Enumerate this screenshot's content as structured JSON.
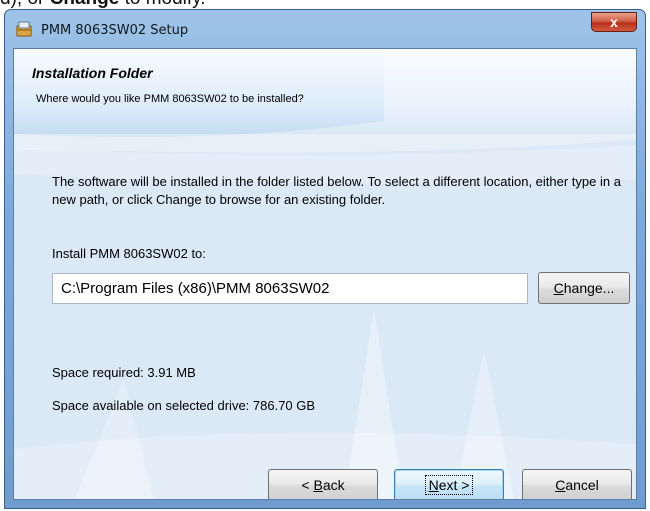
{
  "doc": {
    "prefix": "d), or ",
    "bold": "Change",
    "suffix": " to modify."
  },
  "window": {
    "title": "PMM 8063SW02 Setup",
    "close_label": "x"
  },
  "header": {
    "title": "Installation Folder",
    "subtitle": "Where would you like PMM 8063SW02 to be installed?"
  },
  "body": {
    "description": "The software will be installed in the folder listed below. To select a different location, either type in a new path, or click Change to browse for an existing folder.",
    "install_label": "Install PMM 8063SW02 to:",
    "install_path": "C:\\Program Files (x86)\\PMM 8063SW02",
    "space_required": "Space required: 3.91 MB",
    "space_available": "Space available on selected drive: 786.70 GB"
  },
  "buttons": {
    "change": {
      "mnemonic": "C",
      "rest": "hange..."
    },
    "back": {
      "pre": "< ",
      "mnemonic": "B",
      "rest": "ack"
    },
    "next": {
      "mnemonic": "N",
      "rest": "ext >"
    },
    "cancel": {
      "mnemonic": "C",
      "rest": "ancel"
    }
  },
  "icons": {
    "app": "setup-icon",
    "close": "close-icon"
  }
}
